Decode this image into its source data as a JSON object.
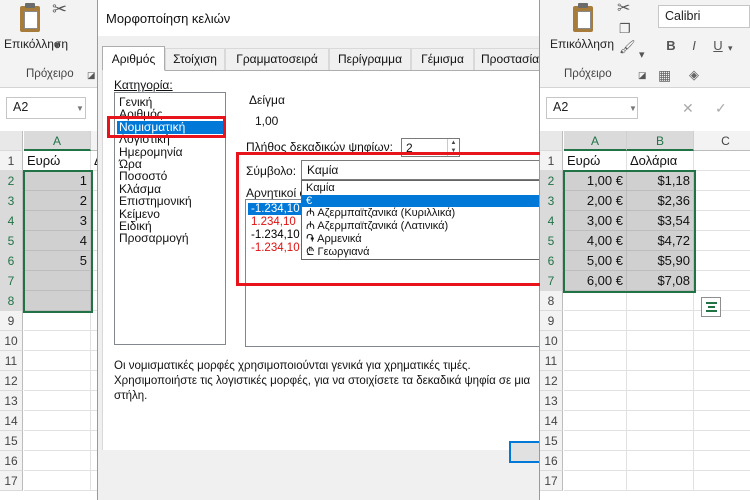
{
  "left_excel": {
    "paste_label": "Επικόλληση",
    "clipboard_group": "Πρόχειρο",
    "namebox": "A2",
    "col_headers": [
      "A"
    ],
    "col_partial": "B",
    "row_numbers": [
      "1",
      "2",
      "3",
      "4",
      "5",
      "6",
      "7",
      "8",
      "9",
      "10",
      "11",
      "12",
      "13",
      "14",
      "15",
      "16",
      "17"
    ],
    "cells": [
      "Ευρώ",
      "1",
      "2",
      "3",
      "4",
      "5",
      "",
      ""
    ],
    "cell_b1_partial": "Δ",
    "font_partial": "Γενική"
  },
  "dialog": {
    "title": "Μορφοποίηση κελιών",
    "tabs": [
      "Αριθμός",
      "Στοίχιση",
      "Γραμματοσειρά",
      "Περίγραμμα",
      "Γέμισμα",
      "Προστασία"
    ],
    "category_label": "Κατηγορία:",
    "categories": [
      "Γενική",
      "Αριθμός",
      "Νομισματική",
      "Λογιστική",
      "Ημερομηνία",
      "Ώρα",
      "Ποσοστό",
      "Κλάσμα",
      "Επιστημονική",
      "Κείμενο",
      "Ειδική",
      "Προσαρμογή"
    ],
    "selected_category": "Νομισματική",
    "sample_label": "Δείγμα",
    "sample_value": "1,00",
    "decimal_label": "Πλήθος δεκαδικών ψηφίων:",
    "decimal_value": "2",
    "symbol_label": "Σύμβολο:",
    "symbol_value": "Καμία",
    "symbol_options": [
      "Καμία",
      "€",
      "₼ Αζερμπαϊτζανικά (Κυριλλικά)",
      "₼ Αζερμπαϊτζανικά (Λατινικά)",
      "֏ Αρμενικά",
      "₾ Γεωργιανά"
    ],
    "symbol_selected": "€",
    "negative_label": "Αρνητικοί α",
    "negative_options": [
      {
        "text": "-1.234,10",
        "red": false,
        "selected": true
      },
      {
        "text": "1.234,10",
        "red": true,
        "selected": false
      },
      {
        "text": "-1.234,10",
        "red": false,
        "selected": false
      },
      {
        "text": "-1.234,10",
        "red": true,
        "selected": false
      }
    ],
    "description": "Οι νομισματικές μορφές χρησιμοποιούνται γενικά για χρηματικές τιμές. Χρησιμοποιήστε τις λογιστικές μορφές, για να στοιχίσετε τα δεκαδικά ψηφία σε μια στήλη."
  },
  "right_excel": {
    "paste_label": "Επικόλληση",
    "clipboard_group": "Πρόχειρο",
    "font_name": "Calibri",
    "format_buttons": [
      "B",
      "I",
      "U"
    ],
    "namebox": "A2",
    "fx_cancel": "✕",
    "fx_enter": "✓",
    "col_headers": [
      "A",
      "B",
      "C"
    ],
    "row_numbers": [
      "1",
      "2",
      "3",
      "4",
      "5",
      "6",
      "7",
      "8",
      "9",
      "10",
      "11",
      "12",
      "13",
      "14",
      "15",
      "16",
      "17"
    ],
    "header_a": "Ευρώ",
    "header_b": "Δολάρια",
    "col_a_values": [
      "1,00 €",
      "2,00 €",
      "3,00 €",
      "4,00 €",
      "5,00 €",
      "6,00 €"
    ],
    "col_b_values": [
      "$1,18",
      "$2,36",
      "$3,54",
      "$4,72",
      "$5,90",
      "$7,08"
    ]
  },
  "colors": {
    "excel_green": "#217346",
    "highlight_red": "#e8141c",
    "selection_blue": "#0078d7"
  }
}
